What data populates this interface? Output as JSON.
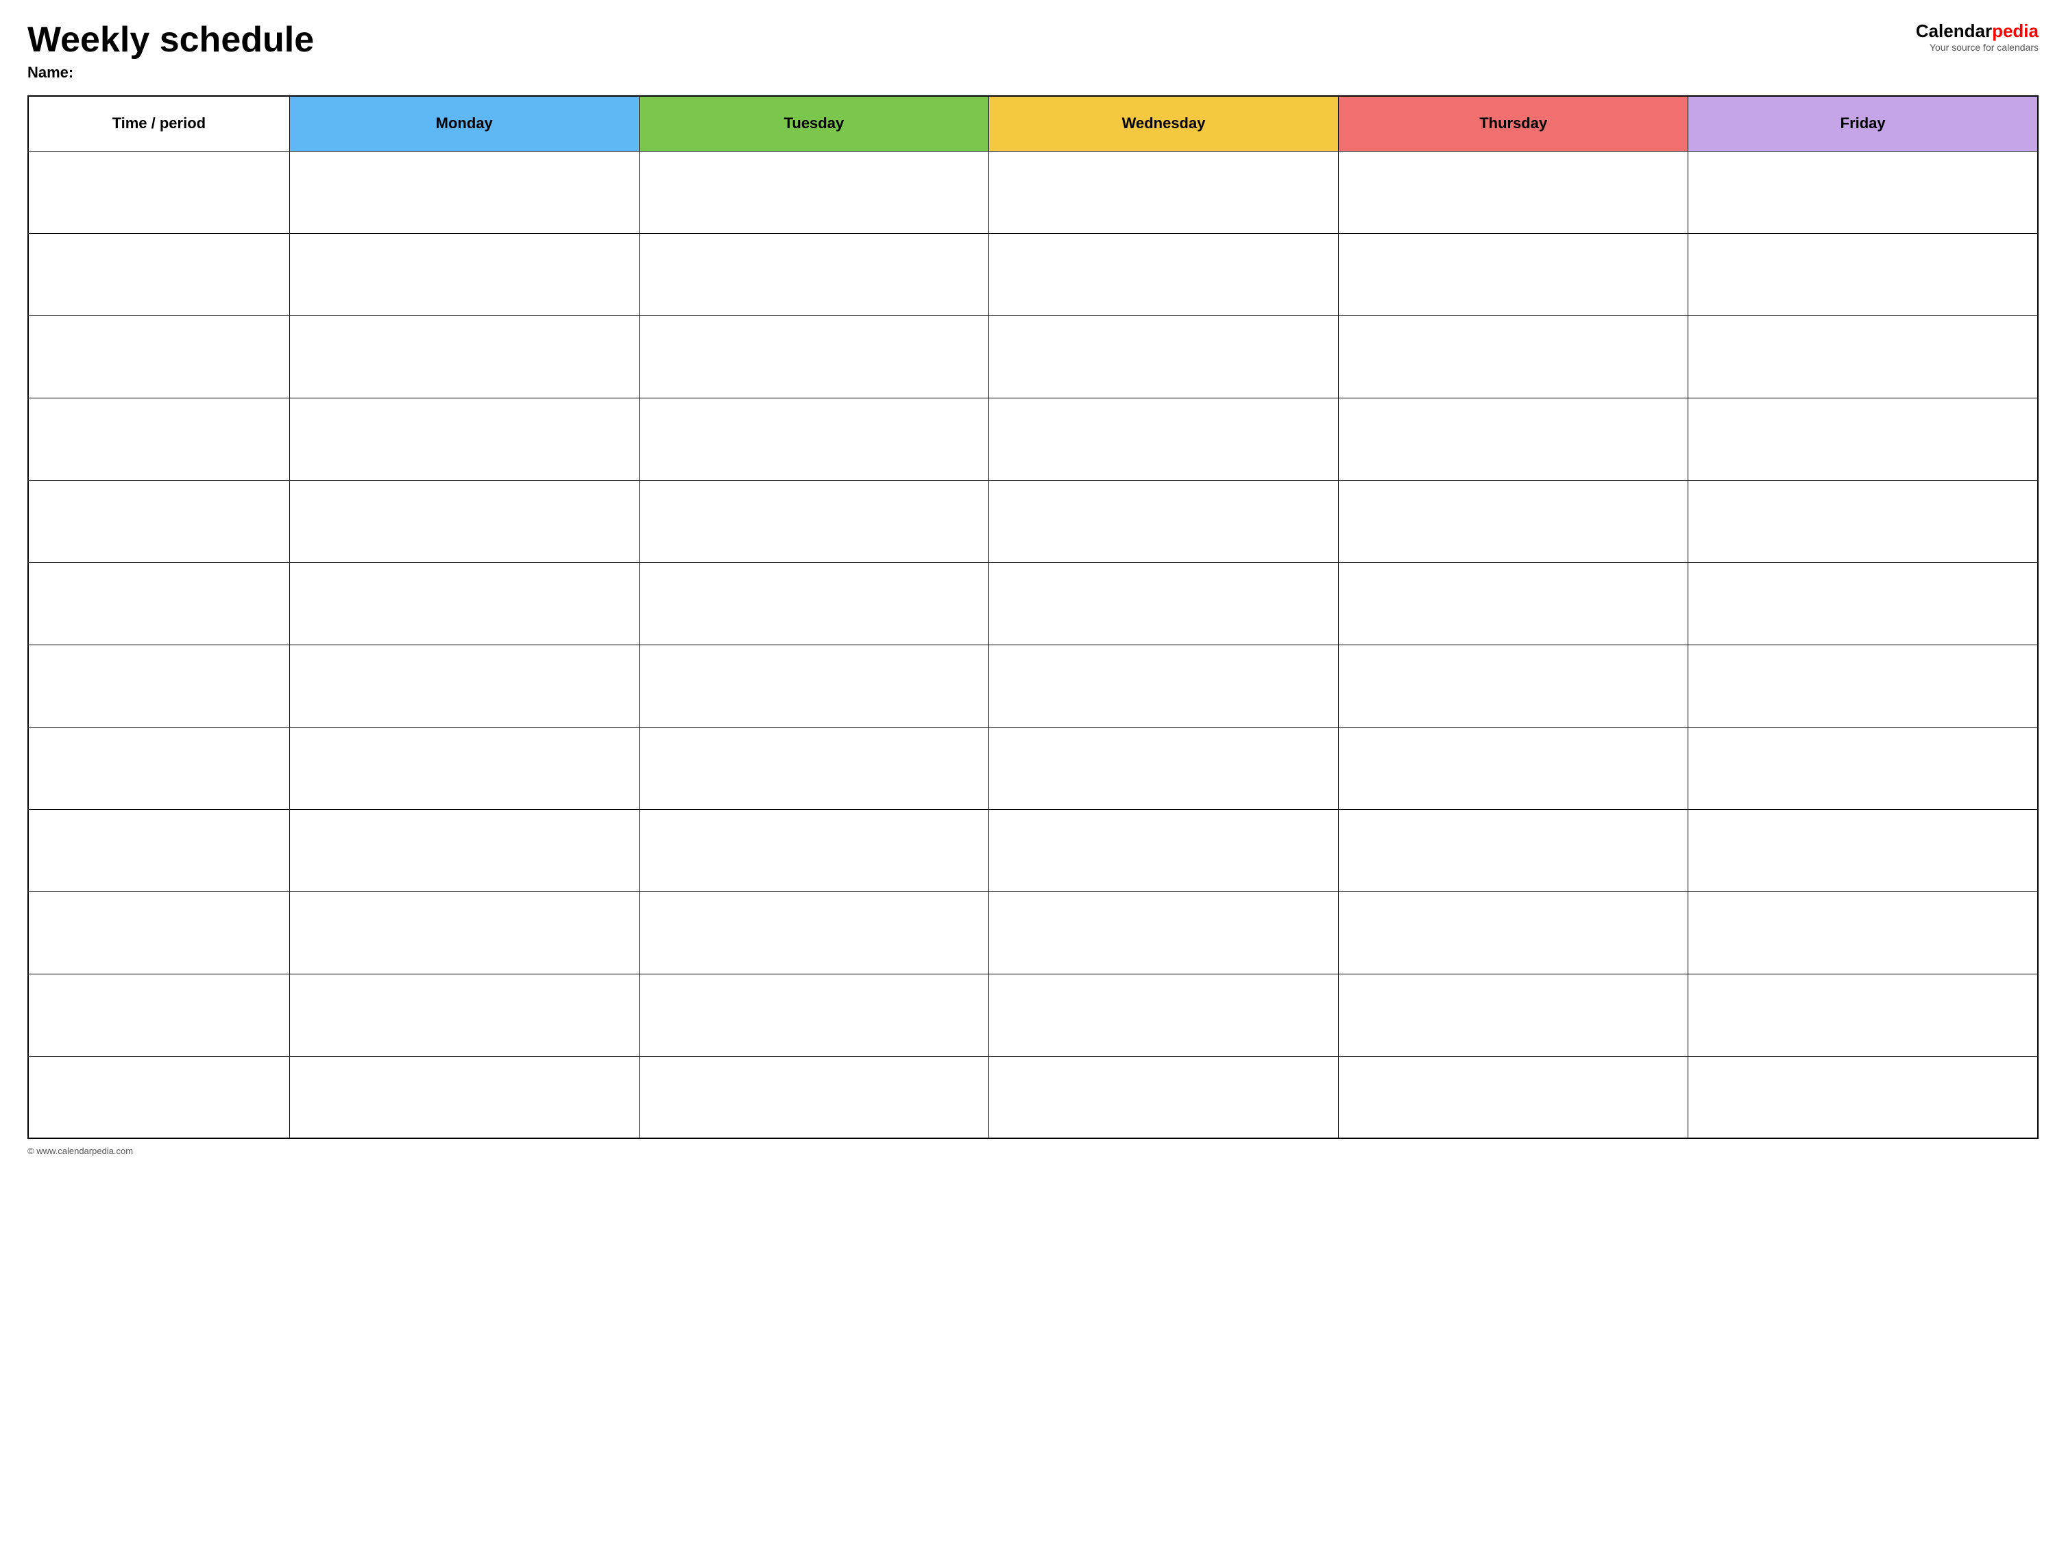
{
  "header": {
    "title": "Weekly schedule",
    "name_label": "Name:",
    "logo": {
      "calendar_part": "Calendar",
      "pedia_part": "pedia",
      "subtitle": "Your source for calendars"
    }
  },
  "table": {
    "columns": [
      {
        "id": "time",
        "label": "Time / period",
        "color": "#ffffff"
      },
      {
        "id": "monday",
        "label": "Monday",
        "color": "#5db8f5"
      },
      {
        "id": "tuesday",
        "label": "Tuesday",
        "color": "#7bc74e"
      },
      {
        "id": "wednesday",
        "label": "Wednesday",
        "color": "#f5c842"
      },
      {
        "id": "thursday",
        "label": "Thursday",
        "color": "#f07070"
      },
      {
        "id": "friday",
        "label": "Friday",
        "color": "#c5a5e8"
      }
    ],
    "row_count": 12
  },
  "footer": {
    "url": "© www.calendarpedia.com"
  }
}
